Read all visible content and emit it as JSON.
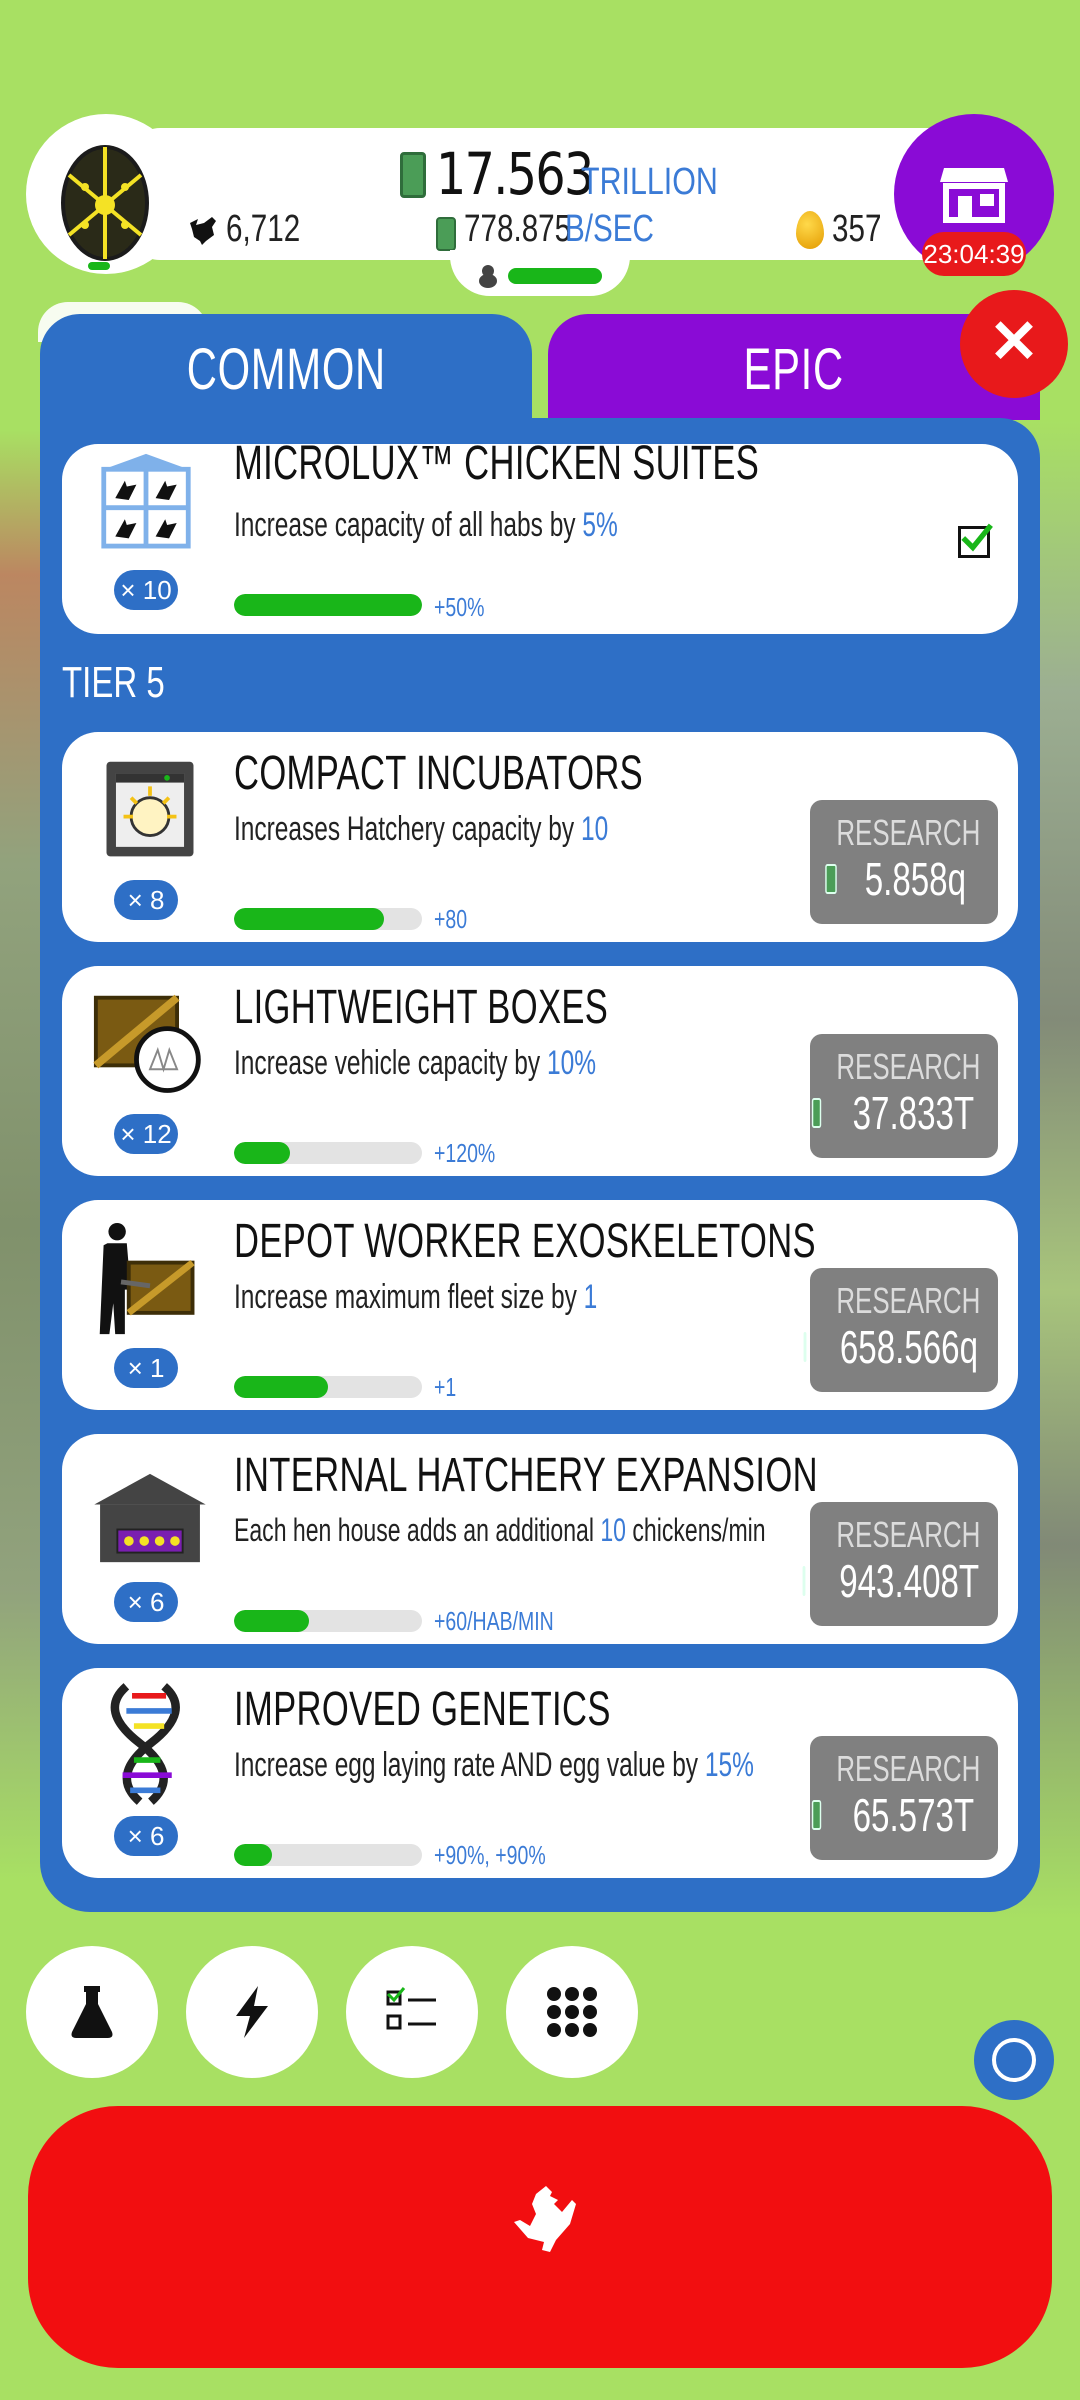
{
  "header": {
    "money_amount": "17.563",
    "money_unit": "TRILLION",
    "rate_value": "778.875",
    "rate_unit": "B/SEC",
    "chicken_count": "6,712",
    "golden_eggs": "357",
    "shop_timer": "23:04:39"
  },
  "tabs": [
    {
      "label": "COMMON"
    },
    {
      "label": "EPIC"
    }
  ],
  "top_item": {
    "title": "MICROLUX™ CHICKEN SUITES",
    "desc_prefix": "Increase capacity of all habs by",
    "desc_value": "5%",
    "multiplier": "× 10",
    "progress_fraction": 1.0,
    "gain": "+50%"
  },
  "tier_label": "TIER 5",
  "research_label": "RESEARCH",
  "items": [
    {
      "title": "COMPACT INCUBATORS",
      "desc_prefix": "Increases Hatchery capacity by",
      "desc_value": "10",
      "desc_suffix": "",
      "multiplier": "× 8",
      "progress_fraction": 0.8,
      "gain": "+80",
      "cost": "5.858q"
    },
    {
      "title": "LIGHTWEIGHT BOXES",
      "desc_prefix": "Increase vehicle capacity by",
      "desc_value": "10%",
      "desc_suffix": "",
      "multiplier": "× 12",
      "progress_fraction": 0.3,
      "gain": "+120%",
      "cost": "37.833T"
    },
    {
      "title": "DEPOT WORKER EXOSKELETONS",
      "desc_prefix": "Increase maximum fleet size by",
      "desc_value": "1",
      "desc_suffix": "",
      "multiplier": "× 1",
      "progress_fraction": 0.5,
      "gain": "+1",
      "cost": "658.566q"
    },
    {
      "title": "INTERNAL HATCHERY EXPANSION",
      "desc_prefix": "Each hen house adds an additional",
      "desc_value": "10",
      "desc_suffix": "chickens/min",
      "multiplier": "× 6",
      "progress_fraction": 0.4,
      "gain": "+60/HAB/MIN",
      "cost": "943.408T"
    },
    {
      "title": "IMPROVED GENETICS",
      "desc_prefix": "Increase egg laying rate AND egg value by",
      "desc_value": "15%",
      "desc_suffix": "",
      "multiplier": "× 6",
      "progress_fraction": 0.2,
      "gain": "+90%, +90%",
      "cost": "65.573T"
    }
  ],
  "bottom_buttons": [
    "flask-icon",
    "lightning-icon",
    "checklist-icon",
    "grid-menu-icon"
  ],
  "colors": {
    "background": "#a8e063",
    "panel_blue": "#2e6fc6",
    "epic_purple": "#8a0bd6",
    "accent_red": "#f20e10",
    "progress_green": "#19b619",
    "research_gray": "#808080"
  }
}
